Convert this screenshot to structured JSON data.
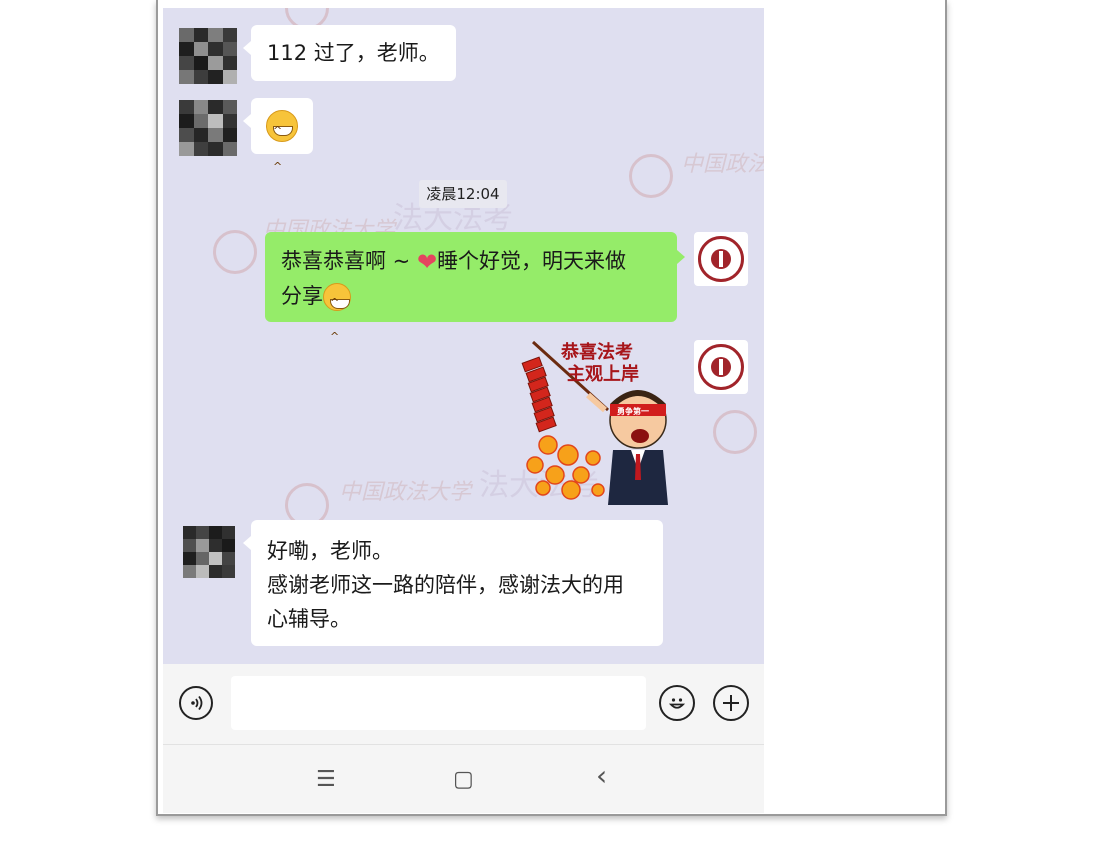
{
  "messages": [
    {
      "side": "left",
      "text": "112 过了，老师。"
    },
    {
      "side": "left",
      "emoji": "grinning-face-emoji"
    },
    {
      "side": "right",
      "line1": "恭喜恭喜啊 ~ ",
      "line1b": "睡个好觉，明天来做",
      "line2": "分享"
    },
    {
      "side": "right",
      "sticker_line1": "恭喜法考",
      "sticker_line2": "主观上岸",
      "sticker_headband": "勇争第一"
    },
    {
      "side": "left",
      "line1": "好嘞，老师。",
      "line2": "感谢老师这一路的陪伴，感谢法大的用",
      "line3": "心辅导。"
    }
  ],
  "timestamp": "凌晨12:04",
  "watermark": {
    "school": "中国政法大学",
    "brand": "法大法考"
  },
  "input_bar": {
    "voice_icon": "voice-icon",
    "emoji_icon": "emoji-icon",
    "plus_icon": "plus-icon",
    "placeholder": ""
  },
  "nav_bar": {
    "menu": "☰",
    "home": "▢",
    "back": "‹"
  },
  "colors": {
    "chat_bg": "#dfdff0",
    "self_bubble": "#95ec69",
    "other_bubble": "#ffffff"
  }
}
